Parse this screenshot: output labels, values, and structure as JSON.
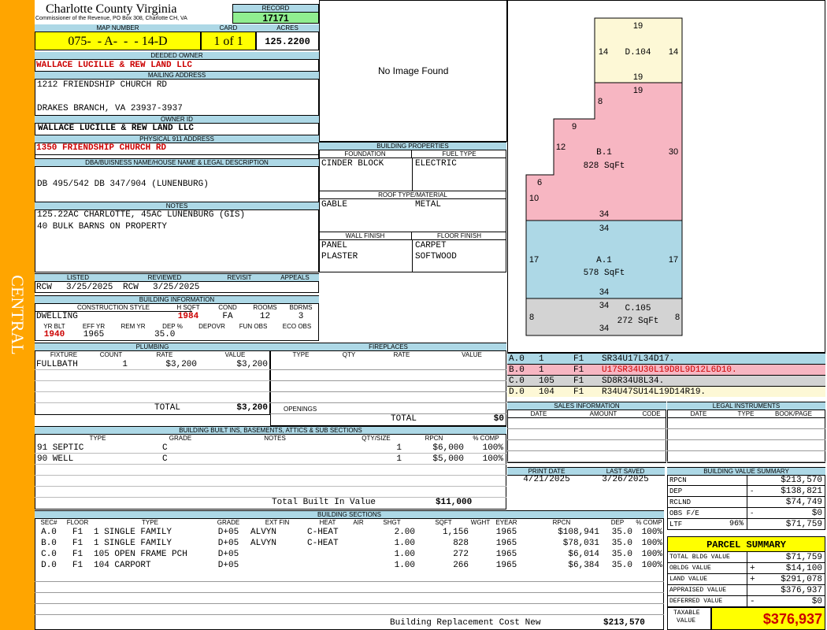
{
  "sidebar": {
    "label": "CENTRAL"
  },
  "header": {
    "county": "Charlotte County Virginia",
    "commissioner": "Commissioner of the Revenue, PO Box 308, Charlotte CH, VA",
    "record_label": "RECORD",
    "record_value": "17171",
    "map_label": "MAP NUMBER",
    "map_value": "075-  - A-  -  - 14-D",
    "card_label": "CARD",
    "card_value": "1 of 1",
    "acres_label": "ACRES",
    "acres_value": "125.2200"
  },
  "owner": {
    "deeded_label": "DEEDED OWNER",
    "deeded_value": "WALLACE LUCILLE & REW LAND LLC",
    "mailing_label": "MAILING ADDRESS",
    "mailing_line1": "1212 FRIENDSHIP CHURCH RD",
    "mailing_line2": "DRAKES BRANCH, VA 23937-3937",
    "owner_id_label": "OWNER ID",
    "owner_id_value": "WALLACE LUCILLE & REW LAND LLC",
    "physical_label": "PHYSICAL 911 ADDRESS",
    "physical_value": "1350 FRIENDSHIP CHURCH RD",
    "dba_label": "DBA/BUISNESS NAME/HOUSE NAME & LEGAL DESCRIPTION",
    "dba_value": "DB 495/542 DB 347/904 (LUNENBURG)",
    "notes_label": "NOTES",
    "notes_line1": "125.22AC CHARLOTTE, 45AC LUNENBURG (GIS)",
    "notes_line2": "40 BULK BARNS ON PROPERTY"
  },
  "photo": {
    "placeholder": "No Image Found"
  },
  "review": {
    "listed_label": "LISTED",
    "reviewed_label": "REVIEWED",
    "revisit_label": "REVISIT",
    "appeals_label": "APPEALS",
    "listed_by": "RCW",
    "listed_date": "3/25/2025",
    "reviewed_by": "RCW",
    "reviewed_date": "3/25/2025"
  },
  "building_info": {
    "title": "BUILDING INFORMATION",
    "style_label": "CONSTRUCTION STYLE",
    "hsqft_label": "H SQFT",
    "cond_label": "COND",
    "rooms_label": "ROOMS",
    "bdrms_label": "BDRMS",
    "style": "DWELLING",
    "hsqft": "1984",
    "cond": "FA",
    "rooms": "12",
    "bdrms": "3",
    "yrblt_label": "YR BLT",
    "effyr_label": "EFF YR",
    "remyr_label": "REM YR",
    "dep_label": "DEP %",
    "depovr_label": "DEPOVR",
    "funobs_label": "FUN OBS",
    "ecoobs_label": "ECO OBS",
    "yrblt": "1940",
    "effyr": "1965",
    "dep": "35.0"
  },
  "building_props": {
    "title": "BUILDING PROPERTIES",
    "foundation_label": "FOUNDATION",
    "fuel_label": "FUEL TYPE",
    "foundation": "CINDER BLOCK",
    "fuel": "ELECTRIC",
    "roof_label": "ROOF TYPE/MATERIAL",
    "roof_type": "GABLE",
    "roof_material": "METAL",
    "wall_label": "WALL FINISH",
    "floor_label": "FLOOR FINISH",
    "wall1": "PANEL",
    "wall2": "PLASTER",
    "floor1": "CARPET",
    "floor2": "SOFTWOOD"
  },
  "sketch": {
    "d_label": "D.104",
    "b_label": "B.1",
    "b_sqft": "828 SqFt",
    "a_label": "A.1",
    "a_sqft": "578 SqFt",
    "c_label": "C.105",
    "c_sqft": "272 SqFt",
    "dims": [
      "19",
      "14",
      "14",
      "19",
      "19",
      "8",
      "9",
      "12",
      "30",
      "6",
      "10",
      "34",
      "34",
      "17",
      "17",
      "34",
      "34",
      "8",
      "8",
      "34"
    ],
    "colors": {
      "d": "#fdf8d6",
      "b": "#f7b6c2",
      "a": "#add8e6",
      "c": "#d3d3d3"
    }
  },
  "traces": [
    {
      "code": "A.0",
      "n": "1",
      "f": "F1",
      "path": "SR34U17L34D17.",
      "color": "#add8e6"
    },
    {
      "code": "B.0",
      "n": "1",
      "f": "F1",
      "path": "U17SR34U30L19D8L9D12L6D10.",
      "color": "#f7b6c2"
    },
    {
      "code": "C.0",
      "n": "105",
      "f": "F1",
      "path": "SD8R34U8L34.",
      "color": "#d3d3d3"
    },
    {
      "code": "D.0",
      "n": "104",
      "f": "F1",
      "path": "R34U47SU14L19D14R19.",
      "color": "#fdf8d6"
    }
  ],
  "plumbing": {
    "title": "PLUMBING",
    "fixture_label": "FIXTURE",
    "count_label": "COUNT",
    "rate_label": "RATE",
    "value_label": "VALUE",
    "rows": [
      {
        "fixture": "FULLBATH",
        "count": "1",
        "rate": "$3,200",
        "value": "$3,200"
      }
    ],
    "total_label": "TOTAL",
    "total": "$3,200"
  },
  "fireplaces": {
    "title": "FIREPLACES",
    "type_label": "TYPE",
    "qty_label": "QTY",
    "rate_label": "RATE",
    "value_label": "VALUE",
    "openings_label": "OPENINGS",
    "total_label": "TOTAL",
    "total": "$0"
  },
  "builtins": {
    "title": "BUILDING BUILT INS, BASEMENTS, ATTICS & SUB SECTIONS",
    "type_label": "TYPE",
    "grade_label": "GRADE",
    "notes_label": "NOTES",
    "qty_label": "QTY/SIZE",
    "rpcn_label": "RPCN",
    "comp_label": "% COMP",
    "rows": [
      {
        "type": "91 SEPTIC",
        "grade": "C",
        "qty": "1",
        "rpcn": "$6,000",
        "comp": "100%"
      },
      {
        "type": "90 WELL",
        "grade": "C",
        "qty": "1",
        "rpcn": "$5,000",
        "comp": "100%"
      }
    ],
    "total_label": "Total Built In Value",
    "total": "$11,000"
  },
  "sales": {
    "title": "SALES INFORMATION",
    "date_label": "DATE",
    "amount_label": "AMOUNT",
    "code_label": "CODE"
  },
  "legal": {
    "title": "LEGAL INSTRUMENTS",
    "date_label": "DATE",
    "type_label": "TYPE",
    "book_label": "BOOK/PAGE"
  },
  "dates": {
    "print_label": "PRINT DATE",
    "saved_label": "LAST SAVED",
    "print": "4/21/2025",
    "saved": "3/26/2025"
  },
  "value_summary": {
    "title": "BUILDING VALUE SUMMARY",
    "rows": [
      {
        "label": "RPCN",
        "sign": "",
        "value": "$213,570"
      },
      {
        "label": "DEP",
        "sign": "-",
        "value": "$138,821"
      },
      {
        "label": "RCLND",
        "sign": "",
        "value": "$74,749"
      },
      {
        "label": "OBS F/E",
        "sign": "-",
        "value": "$0"
      },
      {
        "label": "LTF",
        "pct": "96%",
        "sign": "",
        "value": "$71,759"
      }
    ]
  },
  "parcel": {
    "title": "PARCEL SUMMARY",
    "rows": [
      {
        "label": "TOTAL BLDG VALUE",
        "sign": "",
        "value": "$71,759"
      },
      {
        "label": "OBLDG VALUE",
        "sign": "+",
        "value": "$14,100"
      },
      {
        "label": "LAND VALUE",
        "sign": "+",
        "value": "$291,078"
      },
      {
        "label": "APPRAISED VALUE",
        "sign": "",
        "value": "$376,937"
      },
      {
        "label": "DEFERRED VALUE",
        "sign": "-",
        "value": "$0"
      }
    ],
    "taxable_label1": "TAXABLE",
    "taxable_label2": "VALUE",
    "taxable": "$376,937"
  },
  "sections": {
    "title": "BUILDING SECTIONS",
    "headers": [
      "SEC#",
      "FLOOR",
      "TYPE",
      "GRADE",
      "EXT FIN",
      "HEAT",
      "AIR",
      "SHGT",
      "SQFT",
      "WGHT",
      "EYEAR",
      "RPCN",
      "DEP",
      "% COMP"
    ],
    "rows": [
      [
        "A.0",
        "F1",
        "1 SINGLE FAMILY",
        "D+05",
        "ALVYN",
        "C-HEAT",
        "",
        "2.00",
        "1,156",
        "",
        "1965",
        "$108,941",
        "35.0",
        "100%"
      ],
      [
        "B.0",
        "F1",
        "1 SINGLE FAMILY",
        "D+05",
        "ALVYN",
        "C-HEAT",
        "",
        "1.00",
        "828",
        "",
        "1965",
        "$78,031",
        "35.0",
        "100%"
      ],
      [
        "C.0",
        "F1",
        "105 OPEN FRAME PCH",
        "D+05",
        "",
        "",
        "",
        "1.00",
        "272",
        "",
        "1965",
        "$6,014",
        "35.0",
        "100%"
      ],
      [
        "D.0",
        "F1",
        "104 CARPORT",
        "D+05",
        "",
        "",
        "",
        "1.00",
        "266",
        "",
        "1965",
        "$6,384",
        "35.0",
        "100%"
      ]
    ],
    "total_label": "Building Replacement Cost New",
    "total": "$213,570"
  }
}
